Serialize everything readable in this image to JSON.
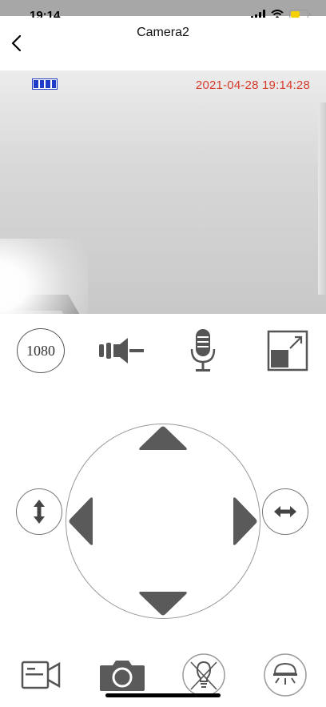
{
  "status_bar": {
    "time": "19:14"
  },
  "header": {
    "title": "Camera2"
  },
  "video": {
    "timestamp": "2021-04-28 19:14:28"
  },
  "controls": {
    "resolution_label": "1080"
  },
  "colors": {
    "timestamp": "#d83a2a",
    "feed_battery": "#1e3cc8",
    "icon_gray": "#555555"
  },
  "icons": {
    "back": "chevron-left-icon",
    "speaker": "speaker-icon",
    "microphone": "microphone-icon",
    "fullscreen": "fullscreen-icon",
    "tilt": "vertical-arrows-icon",
    "pan": "horizontal-arrows-icon",
    "record": "video-record-icon",
    "snapshot": "camera-icon",
    "light_off": "light-bulb-off-icon",
    "alarm": "alarm-siren-icon"
  }
}
